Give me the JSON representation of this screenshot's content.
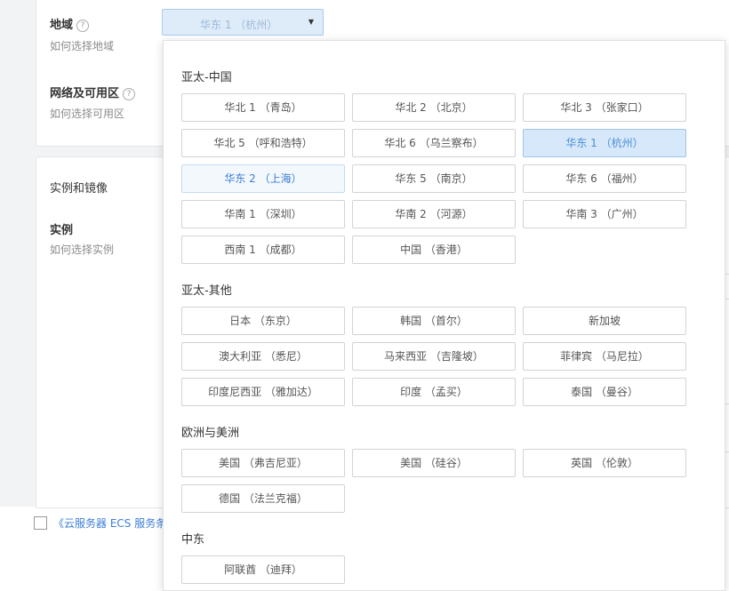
{
  "region_field": {
    "label": "地域",
    "help_text": "如何选择地域",
    "selected_value": "华东 1 （杭州）"
  },
  "network_field": {
    "label": "网络及可用区",
    "help_text": "如何选择可用区"
  },
  "instance_section": {
    "image_label": "实例和镜像",
    "instance_label": "实例",
    "instance_help": "如何选择实例"
  },
  "agreement": {
    "text": "《云服务器 ECS 服务条款"
  },
  "icons": {
    "help": "?",
    "caret": "▼"
  },
  "dropdown": {
    "groups": [
      {
        "title": "亚太-中国",
        "options": [
          "华北 1 （青岛）",
          "华北 2 （北京）",
          "华北 3 （张家口）",
          "华北 5 （呼和浩特）",
          "华北 6 （乌兰察布）",
          "华东 1 （杭州）",
          "华东 2 （上海）",
          "华东 5 （南京）",
          "华东 6 （福州）",
          "华南 1 （深圳）",
          "华南 2 （河源）",
          "华南 3 （广州）",
          "西南 1 （成都）",
          "中国 （香港）"
        ]
      },
      {
        "title": "亚太-其他",
        "options": [
          "日本 （东京）",
          "韩国 （首尔）",
          "新加坡",
          "澳大利亚 （悉尼）",
          "马来西亚 （吉隆坡）",
          "菲律宾 （马尼拉）",
          "印度尼西亚 （雅加达）",
          "印度 （孟买）",
          "泰国 （曼谷）"
        ]
      },
      {
        "title": "欧洲与美洲",
        "options": [
          "美国 （弗吉尼亚）",
          "美国 （硅谷）",
          "英国 （伦敦）",
          "德国 （法兰克福）"
        ]
      },
      {
        "title": "中东",
        "options": [
          "阿联酋 （迪拜）"
        ]
      }
    ]
  }
}
